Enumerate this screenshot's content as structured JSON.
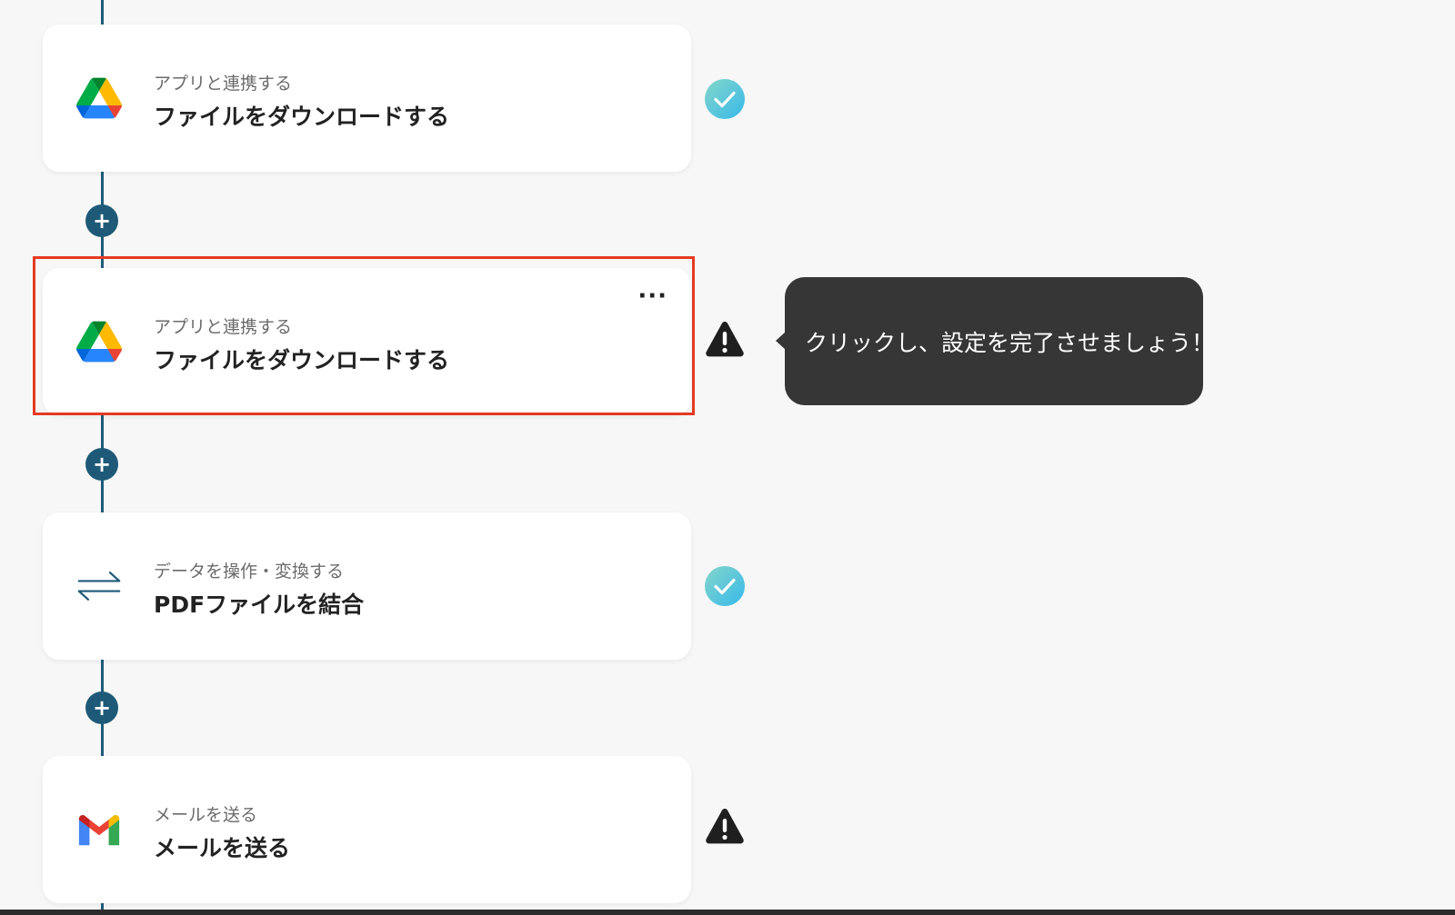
{
  "steps": [
    {
      "category": "アプリと連携する",
      "title": "ファイルをダウンロードする",
      "icon": "google-drive-icon",
      "status": "complete"
    },
    {
      "category": "アプリと連携する",
      "title": "ファイルをダウンロードする",
      "icon": "google-drive-icon",
      "status": "warning",
      "more_label": "···"
    },
    {
      "category": "データを操作・変換する",
      "title": "PDFファイルを結合",
      "icon": "transform-arrows-icon",
      "status": "complete"
    },
    {
      "category": "メールを送る",
      "title": "メールを送る",
      "icon": "gmail-icon",
      "status": "warning"
    }
  ],
  "add_button_label": "+",
  "tooltip": {
    "text": "クリックし、設定を完了させましょう！"
  },
  "colors": {
    "background": "#f7f7f7",
    "flow_line": "#1e5a78",
    "highlight": "#e53a22",
    "tooltip_bg": "#363636",
    "check_gradient_start": "#7bd0d9",
    "check_gradient_end": "#3fbfe6",
    "warning": "#1f1f1f"
  }
}
